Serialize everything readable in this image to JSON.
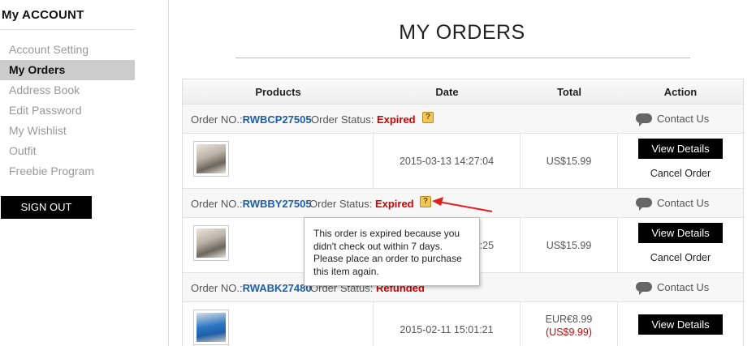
{
  "sidebar": {
    "title": "My ACCOUNT",
    "items": [
      {
        "label": "Account Setting"
      },
      {
        "label": "My Orders"
      },
      {
        "label": "Address Book"
      },
      {
        "label": "Edit Password"
      },
      {
        "label": "My Wishlist"
      },
      {
        "label": "Outfit"
      },
      {
        "label": "Freebie Program"
      }
    ],
    "signout": "SIGN OUT"
  },
  "main": {
    "title": "MY ORDERS",
    "columns": {
      "products": "Products",
      "date": "Date",
      "total": "Total",
      "action": "Action"
    },
    "labels": {
      "order_no": "Order NO.:",
      "order_status": "Order Status:",
      "contact": "Contact Us",
      "view": "View Details",
      "cancel": "Cancel Order",
      "help_icon": "?"
    },
    "orders": [
      {
        "number": "RWBCP27505",
        "status": "Expired",
        "date": "2015-03-13 14:27:04",
        "total": "US$15.99",
        "total_alt": ""
      },
      {
        "number": "RWBBY27505",
        "status": "Expired",
        "date": "2015-03-13 14:27:25",
        "total": "US$15.99",
        "total_alt": ""
      },
      {
        "number": "RWABK27480",
        "status": "Refunded",
        "date": "2015-02-11 15:01:21",
        "total": "EUR€8.99",
        "total_alt": "(US$9.99)"
      }
    ],
    "tooltip": "This order is expired because you didn't check out within 7 days. Please place an order to purchase this item again."
  },
  "colors": {
    "link": "#1b5fa8",
    "status": "#d60000",
    "button": "#000000",
    "active_nav": "#cccccc"
  },
  "icons": {
    "status_help": "question-icon",
    "contact": "chat-bubble-icon",
    "annotation": "red-arrow"
  }
}
